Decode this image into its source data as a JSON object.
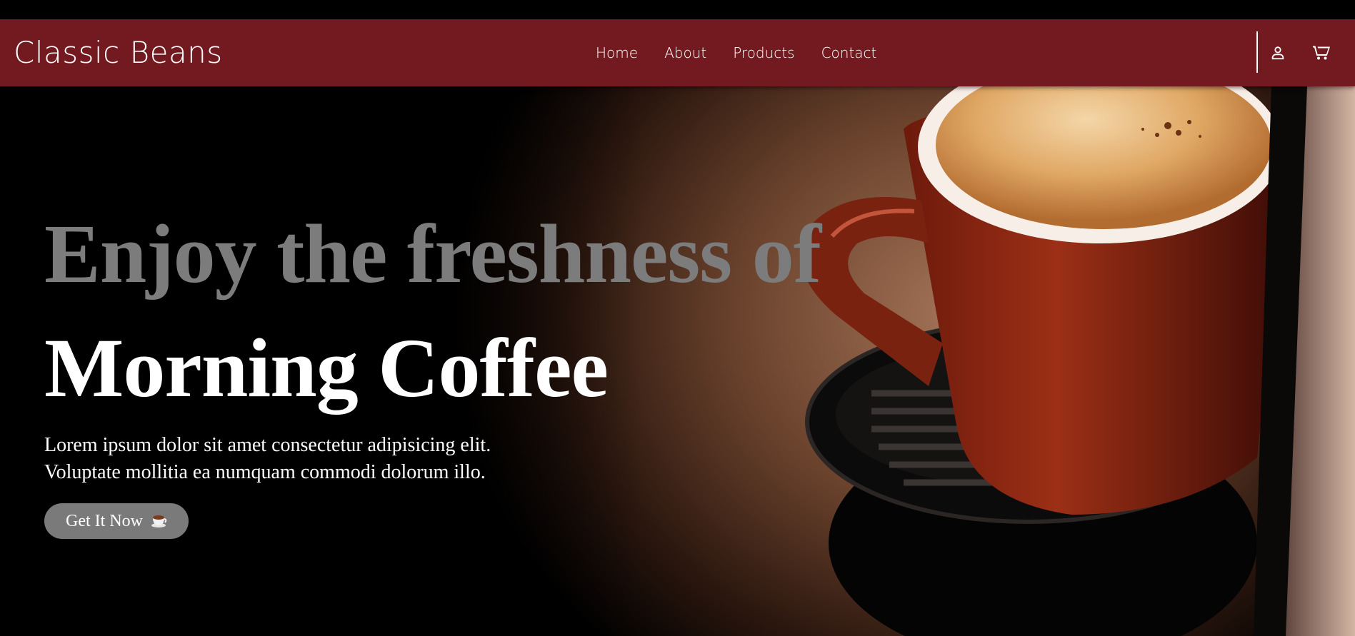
{
  "header": {
    "brand": "Classic Beans",
    "nav": [
      "Home",
      "About",
      "Products",
      "Contact"
    ],
    "icons": [
      "user-icon",
      "cart-icon"
    ],
    "background_color": "#721a20"
  },
  "hero": {
    "headline_top": "Enjoy the freshness of",
    "headline_main": "Morning Coffee",
    "description_line1": "Lorem ipsum dolor sit amet consectetur adipisicing elit.",
    "description_line2": "Voluptate mollitia ea numquam commodi dolorum illo.",
    "cta_label": "Get It Now",
    "cta_icon": "coffee-cup-icon"
  }
}
